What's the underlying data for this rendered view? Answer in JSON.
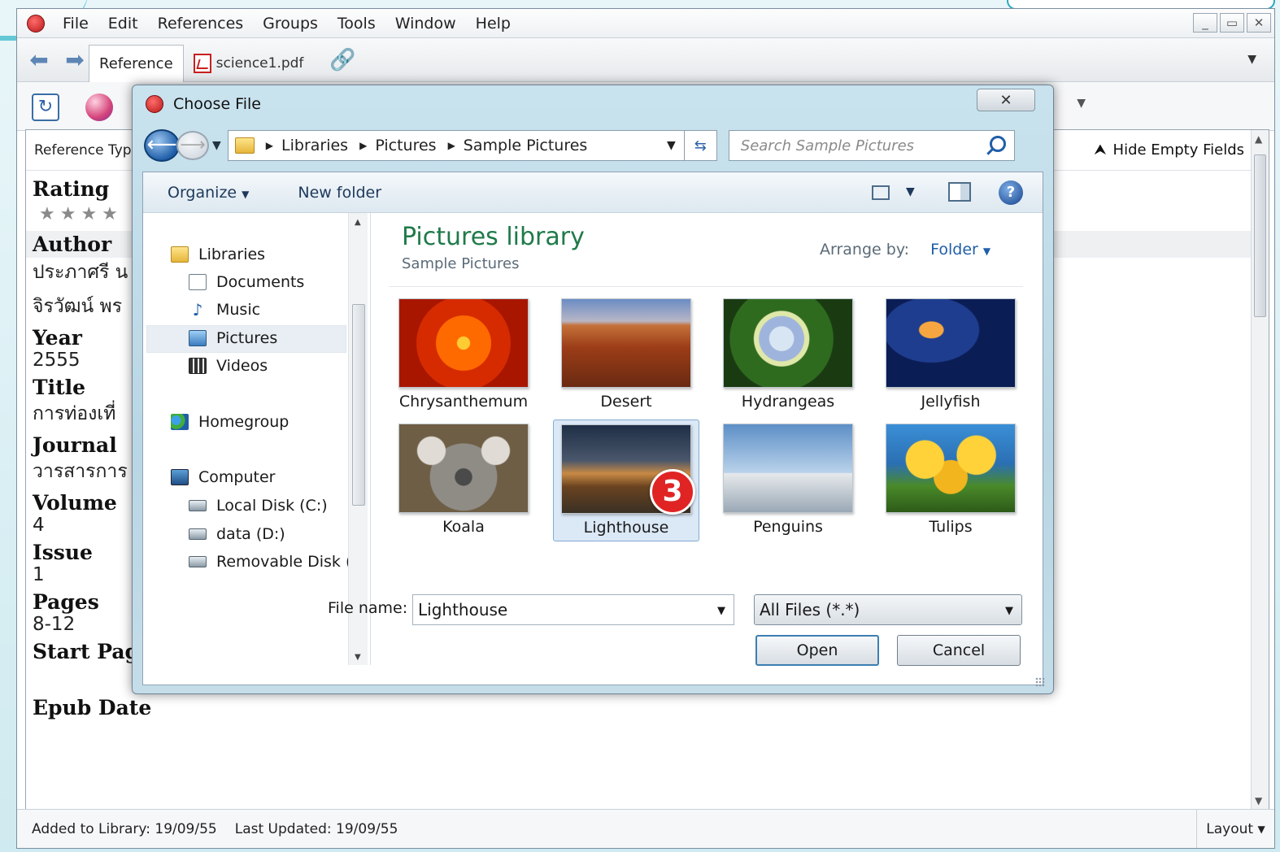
{
  "menubar": {
    "items": [
      "File",
      "Edit",
      "References",
      "Groups",
      "Tools",
      "Window",
      "Help"
    ],
    "controls": [
      "_",
      "▭",
      "✕"
    ]
  },
  "tabs": {
    "reference": "Reference",
    "pdf": "science1.pdf"
  },
  "panel": {
    "reference_type_label": "Reference Typ",
    "hide_empty_fields": "Hide Empty Fields",
    "fields": [
      {
        "label": "Rating",
        "value": ""
      },
      {
        "label": "Author",
        "value": "ประภาศรี น"
      },
      {
        "label": "",
        "value": "จิรวัฒน์ พร"
      },
      {
        "label": "Year",
        "value": "2555"
      },
      {
        "label": "Title",
        "value": "การท่องเที่"
      },
      {
        "label": "Journal",
        "value": "วารสารการ"
      },
      {
        "label": "Volume",
        "value": "4"
      },
      {
        "label": "Issue",
        "value": "1"
      },
      {
        "label": "Pages",
        "value": "8-12"
      },
      {
        "label": "Start Page",
        "value": ""
      },
      {
        "label": "Epub Date",
        "value": ""
      }
    ],
    "rating_stars": "★★★★"
  },
  "status": {
    "added": "Added to Library: 19/09/55",
    "updated": "Last Updated: 19/09/55",
    "layout": "Layout"
  },
  "dialog": {
    "title": "Choose File",
    "close": "✕",
    "breadcrumbs": [
      "Libraries",
      "Pictures",
      "Sample Pictures"
    ],
    "search_placeholder": "Search Sample Pictures",
    "organize": "Organize",
    "new_folder": "New folder",
    "nav": {
      "libraries": "Libraries",
      "documents": "Documents",
      "music": "Music",
      "pictures": "Pictures",
      "videos": "Videos",
      "homegroup": "Homegroup",
      "computer": "Computer",
      "local_disk": "Local Disk (C:)",
      "data_disk": "data (D:)",
      "removable": "Removable Disk ("
    },
    "library_title": "Pictures library",
    "library_subtitle": "Sample Pictures",
    "arrange_label": "Arrange by:",
    "arrange_value": "Folder",
    "files": [
      "Chrysanthemum",
      "Desert",
      "Hydrangeas",
      "Jellyfish",
      "Koala",
      "Lighthouse",
      "Penguins",
      "Tulips"
    ],
    "selected_file": "Lighthouse",
    "step_badge": "3",
    "file_name_label": "File name:",
    "file_name_value": "Lighthouse",
    "file_type": "All Files (*.*)",
    "open_button": "Open",
    "cancel_button": "Cancel"
  }
}
